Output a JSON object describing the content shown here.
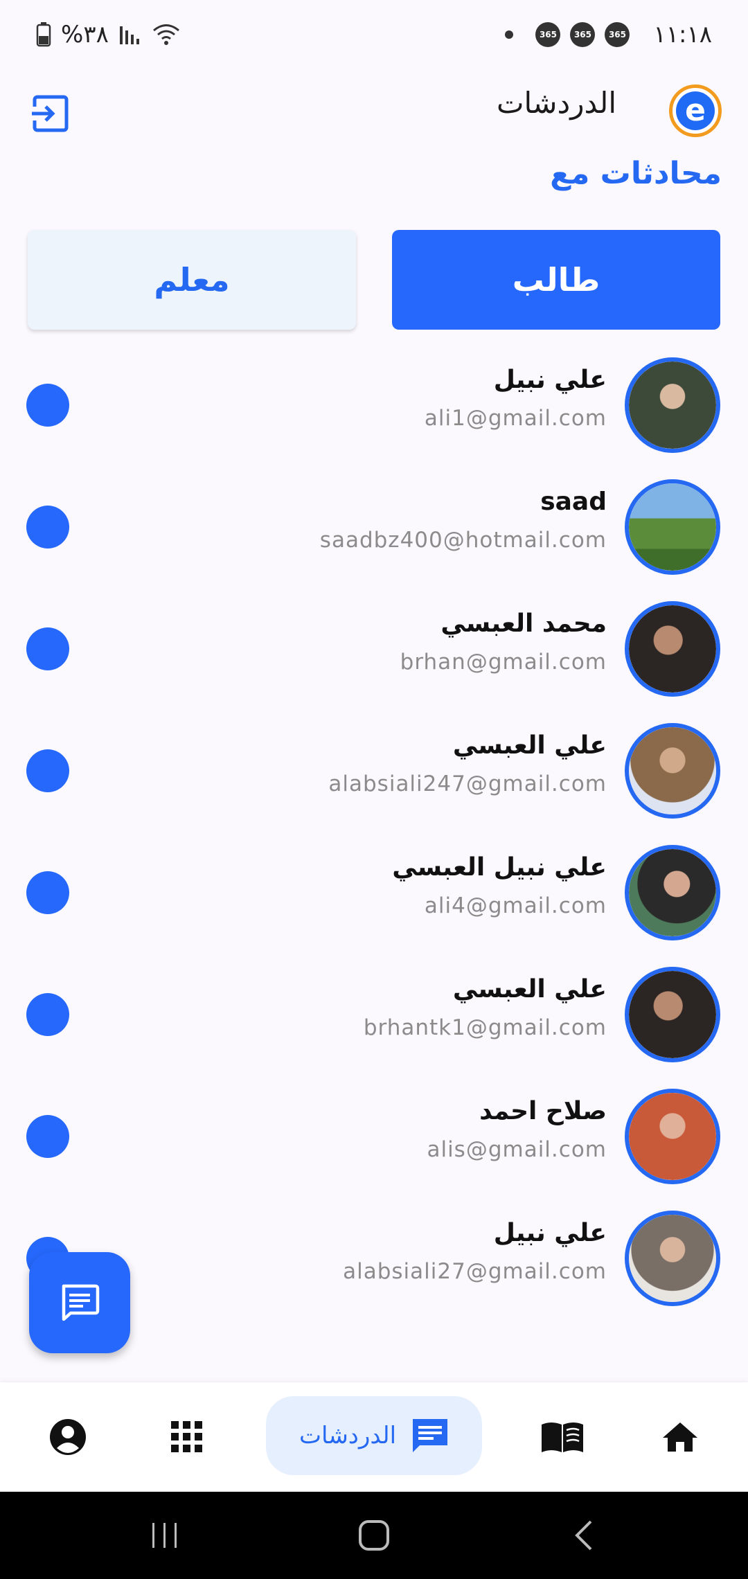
{
  "status_bar": {
    "time": "١١:١٨",
    "battery": "%٣٨",
    "badge": "365"
  },
  "header": {
    "title": "الدردشات"
  },
  "section": {
    "label": "محادثات مع"
  },
  "segments": {
    "student": "طالب",
    "teacher": "معلم"
  },
  "chats": [
    {
      "name": "علي نبيل",
      "email": "ali1@gmail.com",
      "avatar_color": "#3d4a3a"
    },
    {
      "name": "saad",
      "email": "saadbz400@hotmail.com",
      "avatar_color": "#6aa2d8"
    },
    {
      "name": "محمد العبسي",
      "email": "brhan@gmail.com",
      "avatar_color": "#2b2623"
    },
    {
      "name": "علي العبسي",
      "email": "alabsiali247@gmail.com",
      "avatar_color": "#8a6a4a"
    },
    {
      "name": "علي نبيل العبسي",
      "email": "ali4@gmail.com",
      "avatar_color": "#4d5a4a"
    },
    {
      "name": "علي العبسي",
      "email": "brhantk1@gmail.com",
      "avatar_color": "#2b2623"
    },
    {
      "name": "صلاح احمد",
      "email": "alis@gmail.com",
      "avatar_color": "#c85a3a"
    },
    {
      "name": "علي نبيل",
      "email": "alabsiali27@gmail.com",
      "avatar_color": "#7a6f66"
    }
  ],
  "bottom_nav": {
    "chats_label": "الدردشات"
  },
  "colors": {
    "accent": "#2668fb",
    "logo_ring": "#f29b1f"
  }
}
